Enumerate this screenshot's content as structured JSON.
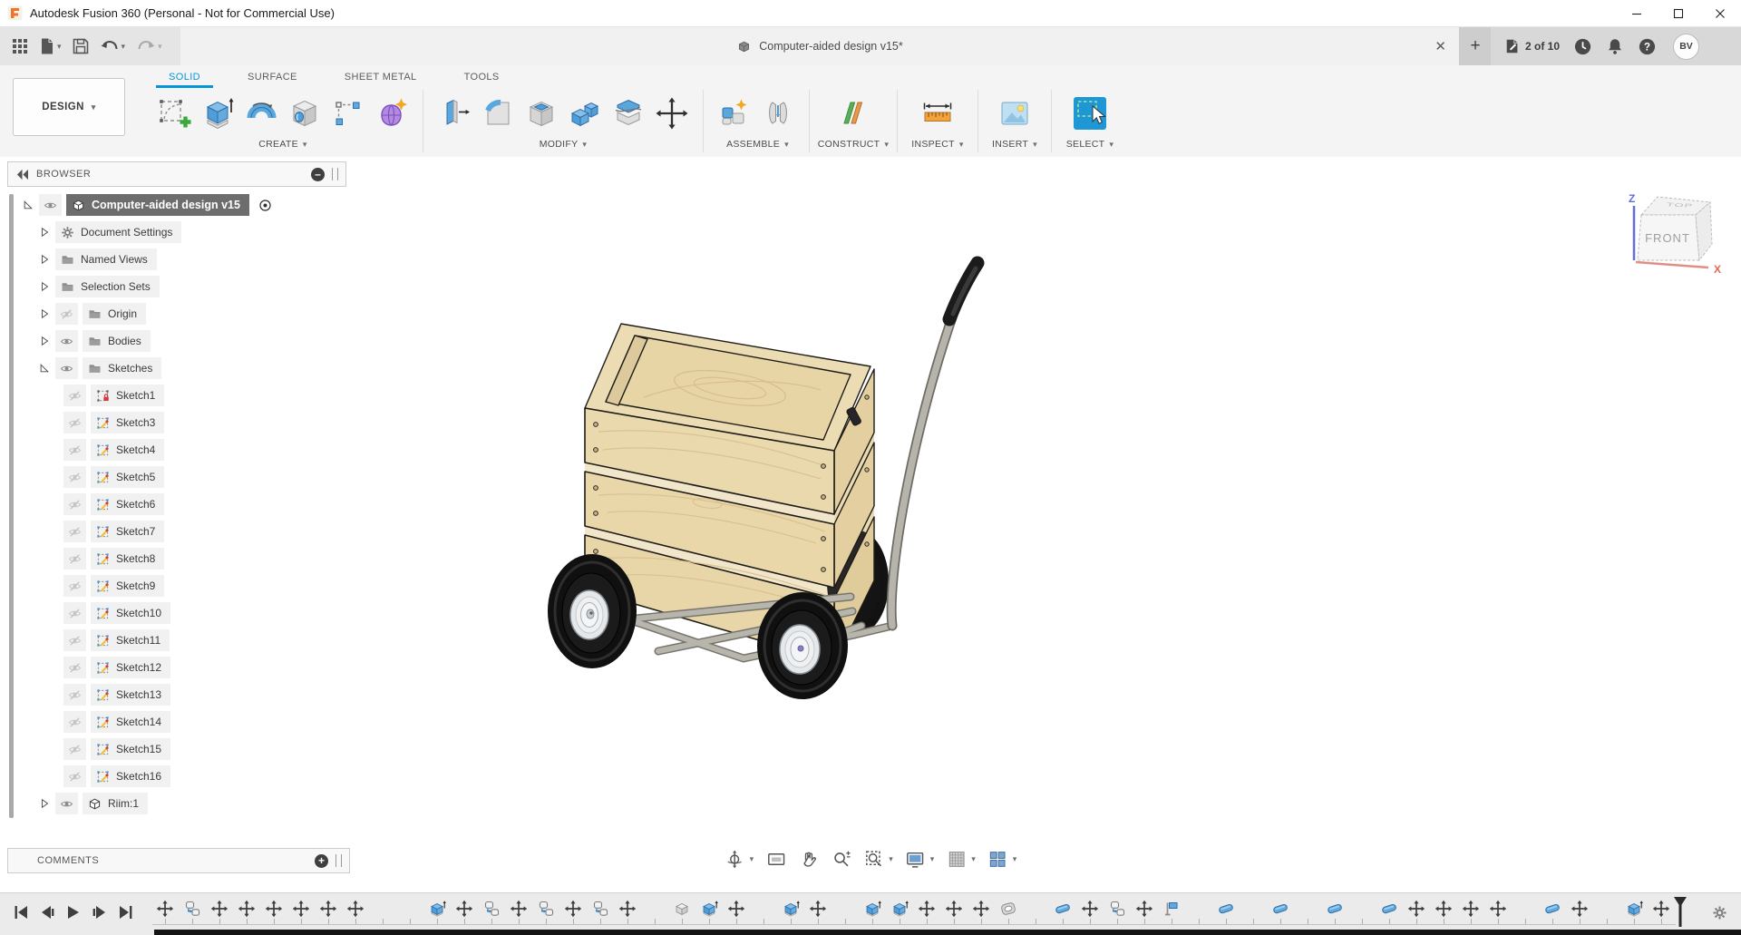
{
  "window": {
    "title": "Autodesk Fusion 360 (Personal - Not for Commercial Use)"
  },
  "document_tab": {
    "title": "Computer-aided design v15*",
    "close_glyph": "✕"
  },
  "account": {
    "version_indicator": "2 of 10",
    "avatar_initials": "BV",
    "plus_glyph": "+"
  },
  "ribbon": {
    "workspace_selector": "DESIGN",
    "tabs": [
      {
        "label": "SOLID",
        "active": true
      },
      {
        "label": "SURFACE",
        "active": false
      },
      {
        "label": "SHEET METAL",
        "active": false
      },
      {
        "label": "TOOLS",
        "active": false
      }
    ],
    "groups": [
      {
        "label": "CREATE"
      },
      {
        "label": "MODIFY"
      },
      {
        "label": "ASSEMBLE"
      },
      {
        "label": "CONSTRUCT"
      },
      {
        "label": "INSPECT"
      },
      {
        "label": "INSERT"
      },
      {
        "label": "SELECT"
      }
    ]
  },
  "browser": {
    "title": "BROWSER",
    "rows": [
      {
        "label": "Computer-aided design v15",
        "type": "root",
        "tri": "open",
        "eye": "on",
        "selected": true,
        "target": true
      },
      {
        "label": "Document Settings",
        "icon": "gear",
        "tri": "closed",
        "indent": 1
      },
      {
        "label": "Named Views",
        "icon": "folder",
        "tri": "closed",
        "indent": 1
      },
      {
        "label": "Selection Sets",
        "icon": "folder",
        "tri": "closed",
        "indent": 1
      },
      {
        "label": "Origin",
        "icon": "folder",
        "tri": "closed",
        "eye": "off",
        "indent": 1
      },
      {
        "label": "Bodies",
        "icon": "folder",
        "tri": "closed",
        "eye": "on",
        "indent": 1
      },
      {
        "label": "Sketches",
        "icon": "folder",
        "tri": "open",
        "eye": "on",
        "indent": 1
      },
      {
        "label": "Sketch1",
        "icon": "sketchlock",
        "eye": "off",
        "indent": 2
      },
      {
        "label": "Sketch3",
        "icon": "sketch",
        "eye": "off",
        "indent": 2
      },
      {
        "label": "Sketch4",
        "icon": "sketch",
        "eye": "off",
        "indent": 2
      },
      {
        "label": "Sketch5",
        "icon": "sketch",
        "eye": "off",
        "indent": 2
      },
      {
        "label": "Sketch6",
        "icon": "sketch",
        "eye": "off",
        "indent": 2
      },
      {
        "label": "Sketch7",
        "icon": "sketch",
        "eye": "off",
        "indent": 2
      },
      {
        "label": "Sketch8",
        "icon": "sketch",
        "eye": "off",
        "indent": 2
      },
      {
        "label": "Sketch9",
        "icon": "sketch",
        "eye": "off",
        "indent": 2
      },
      {
        "label": "Sketch10",
        "icon": "sketch",
        "eye": "off",
        "indent": 2
      },
      {
        "label": "Sketch11",
        "icon": "sketch",
        "eye": "off",
        "indent": 2
      },
      {
        "label": "Sketch12",
        "icon": "sketch",
        "eye": "off",
        "indent": 2
      },
      {
        "label": "Sketch13",
        "icon": "sketch",
        "eye": "off",
        "indent": 2
      },
      {
        "label": "Sketch14",
        "icon": "sketch",
        "eye": "off",
        "indent": 2
      },
      {
        "label": "Sketch15",
        "icon": "sketch",
        "eye": "off",
        "indent": 2
      },
      {
        "label": "Sketch16",
        "icon": "sketch",
        "eye": "off",
        "indent": 2
      },
      {
        "label": "Riim:1",
        "icon": "cube",
        "tri": "closed",
        "eye": "on",
        "indent": 1
      }
    ]
  },
  "comments": {
    "title": "COMMENTS"
  },
  "viewcube": {
    "front_label": "FRONT",
    "top_label": "TOP",
    "z_axis": "Z",
    "x_axis": "X"
  },
  "timeline": {
    "items": [
      "move",
      "component",
      "move",
      "move",
      "move",
      "move",
      "move",
      "move",
      "sketch",
      "sketch",
      "extrude",
      "move",
      "component",
      "move",
      "component",
      "move",
      "component",
      "move",
      "sketch",
      "graybox",
      "extrude",
      "move",
      "sketch",
      "extrude",
      "move",
      "sketch",
      "extrude",
      "extrude",
      "move",
      "move",
      "move",
      "torus",
      "sketch",
      "pill",
      "move",
      "component",
      "move",
      "plane",
      "sketch",
      "pill",
      "sketch",
      "pill",
      "sketch",
      "pill",
      "sketch",
      "pill",
      "move",
      "move",
      "move",
      "move",
      "sketch",
      "pill",
      "move",
      "sketch",
      "extrude",
      "move"
    ]
  },
  "colors": {
    "accent_blue": "#0696d7",
    "select_button": "#1f97d4",
    "wood": "#ead9ad",
    "metal": "#b6b4ab",
    "tire": "#141414"
  }
}
